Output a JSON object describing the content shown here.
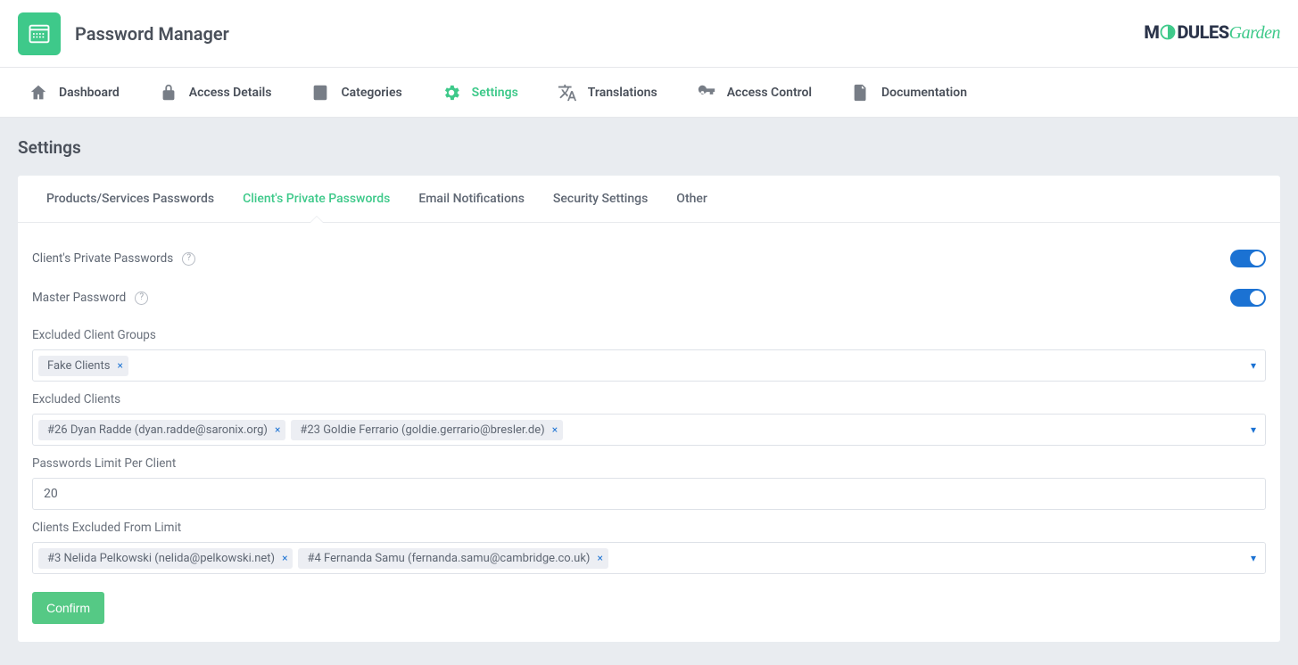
{
  "header": {
    "app_title": "Password Manager",
    "brand_prefix": "M",
    "brand_mid": "DULES",
    "brand_suffix": "Garden"
  },
  "nav": {
    "items": [
      {
        "label": "Dashboard"
      },
      {
        "label": "Access Details"
      },
      {
        "label": "Categories"
      },
      {
        "label": "Settings"
      },
      {
        "label": "Translations"
      },
      {
        "label": "Access Control"
      },
      {
        "label": "Documentation"
      }
    ],
    "active_index": 3
  },
  "page": {
    "title": "Settings"
  },
  "tabs": {
    "items": [
      {
        "label": "Products/Services Passwords"
      },
      {
        "label": "Client's Private Passwords"
      },
      {
        "label": "Email Notifications"
      },
      {
        "label": "Security Settings"
      },
      {
        "label": "Other"
      }
    ],
    "active_index": 1
  },
  "form": {
    "clients_private_passwords": {
      "label": "Client's Private Passwords",
      "value": true
    },
    "master_password": {
      "label": "Master Password",
      "value": true
    },
    "excluded_client_groups": {
      "label": "Excluded Client Groups",
      "chips": [
        "Fake Clients"
      ]
    },
    "excluded_clients": {
      "label": "Excluded Clients",
      "chips": [
        "#26 Dyan Radde (dyan.radde@saronix.org)",
        "#23 Goldie Ferrario (goldie.gerrario@bresler.de)"
      ]
    },
    "passwords_limit": {
      "label": "Passwords Limit Per Client",
      "value": "20"
    },
    "clients_excluded_from_limit": {
      "label": "Clients Excluded From Limit",
      "chips": [
        "#3 Nelida Pelkowski (nelida@pelkowski.net)",
        "#4 Fernanda Samu (fernanda.samu@cambridge.co.uk)"
      ]
    },
    "confirm_label": "Confirm"
  }
}
